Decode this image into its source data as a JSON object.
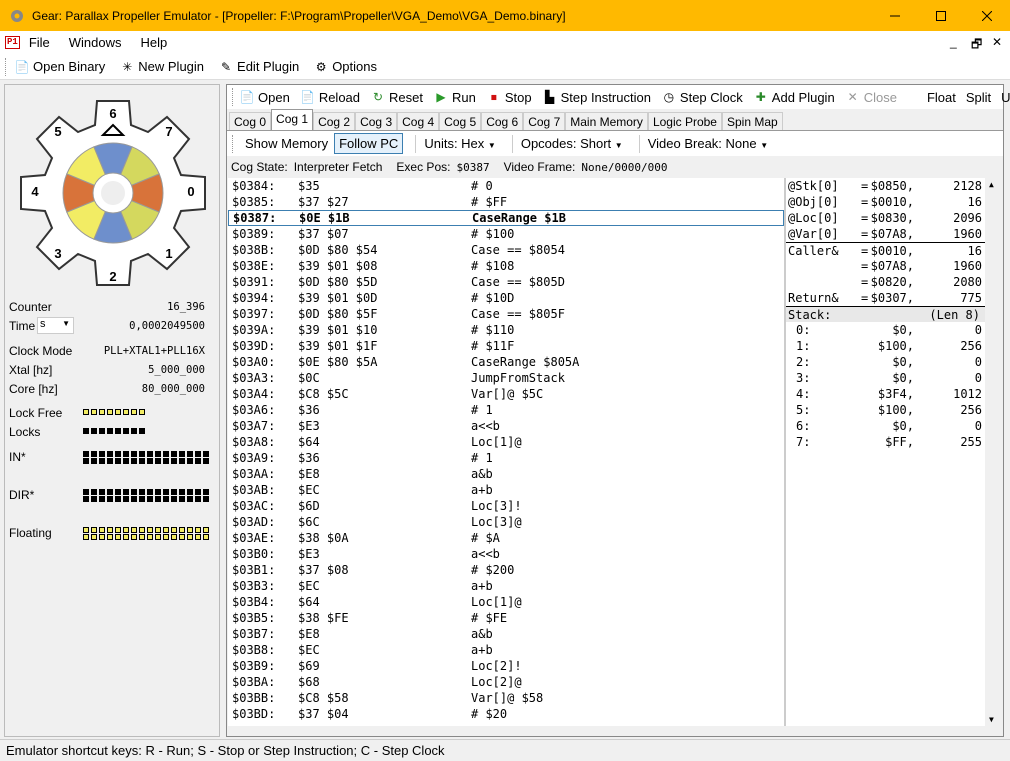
{
  "window": {
    "title": "Gear: Parallax Propeller Emulator - [Propeller: F:\\Program\\Propeller\\VGA_Demo\\VGA_Demo.binary]",
    "minimize": "—",
    "maximize": "☐",
    "close": "✕"
  },
  "menu": {
    "logo": "P1",
    "items": [
      "File",
      "Windows",
      "Help"
    ],
    "mdi_min": "_",
    "mdi_restore": "🗗",
    "mdi_close": "✕"
  },
  "toolbar1": {
    "open_binary": "Open Binary",
    "new_plugin": "New Plugin",
    "edit_plugin": "Edit Plugin",
    "options": "Options"
  },
  "gear": {
    "cogs": [
      "0",
      "1",
      "2",
      "3",
      "4",
      "5",
      "6",
      "7"
    ],
    "colors": {
      "blue": "#6e8fcc",
      "yellow": "#f2ec64",
      "orange": "#d8733a",
      "olive": "#d4d85e"
    }
  },
  "info": {
    "counter_label": "Counter",
    "counter_value": "16_396",
    "time_label": "Time",
    "time_unit": "s",
    "time_value": "0,0002049500",
    "clock_mode_label": "Clock Mode",
    "clock_mode_value": "PLL+XTAL1+PLL16X",
    "xtal_label": "Xtal [hz]",
    "xtal_value": "5_000_000",
    "core_label": "Core [hz]",
    "core_value": "80_000_000",
    "lock_free_label": "Lock Free",
    "locks_label": "Locks",
    "in_label": "IN*",
    "dir_label": "DIR*",
    "floating_label": "Floating"
  },
  "toolbar2": {
    "open": "Open",
    "reload": "Reload",
    "reset": "Reset",
    "run": "Run",
    "stop": "Stop",
    "step_instruction": "Step Instruction",
    "step_clock": "Step Clock",
    "add_plugin": "Add Plugin",
    "close": "Close",
    "float": "Float",
    "split": "Split",
    "unsplit": "Unsplit"
  },
  "tabs": [
    "Cog 0",
    "Cog 1",
    "Cog 2",
    "Cog 3",
    "Cog 4",
    "Cog 5",
    "Cog 6",
    "Cog 7",
    "Main Memory",
    "Logic Probe",
    "Spin Map"
  ],
  "toolbar3": {
    "show_memory": "Show Memory",
    "follow_pc": "Follow PC",
    "units": "Units: Hex",
    "opcodes": "Opcodes: Short",
    "video_break": "Video Break: None"
  },
  "cog_status": {
    "state_label": "Cog State:",
    "state_value": "Interpreter Fetch",
    "exec_label": "Exec Pos:",
    "exec_value": "$0387",
    "video_label": "Video Frame:",
    "video_value": "None/0000/000"
  },
  "code": [
    [
      "$0384:",
      "$35",
      "# 0"
    ],
    [
      "$0385:",
      "$37 $27",
      "# $FF"
    ],
    [
      "$0387:",
      "$0E $1B",
      "CaseRange $1B"
    ],
    [
      "$0389:",
      "$37 $07",
      "# $100"
    ],
    [
      "$038B:",
      "$0D $80 $54",
      "Case == $8054"
    ],
    [
      "$038E:",
      "$39 $01 $08",
      "# $108"
    ],
    [
      "$0391:",
      "$0D $80 $5D",
      "Case == $805D"
    ],
    [
      "$0394:",
      "$39 $01 $0D",
      "# $10D"
    ],
    [
      "$0397:",
      "$0D $80 $5F",
      "Case == $805F"
    ],
    [
      "$039A:",
      "$39 $01 $10",
      "# $110"
    ],
    [
      "$039D:",
      "$39 $01 $1F",
      "# $11F"
    ],
    [
      "$03A0:",
      "$0E $80 $5A",
      "CaseRange $805A"
    ],
    [
      "$03A3:",
      "$0C",
      "JumpFromStack"
    ],
    [
      "$03A4:",
      "$C8 $5C",
      "Var[]@ $5C"
    ],
    [
      "$03A6:",
      "$36",
      "# 1"
    ],
    [
      "$03A7:",
      "$E3",
      "a<<b"
    ],
    [
      "$03A8:",
      "$64",
      "Loc[1]@"
    ],
    [
      "$03A9:",
      "$36",
      "# 1"
    ],
    [
      "$03AA:",
      "$E8",
      "a&b"
    ],
    [
      "$03AB:",
      "$EC",
      "a+b"
    ],
    [
      "$03AC:",
      "$6D",
      "Loc[3]!"
    ],
    [
      "$03AD:",
      "$6C",
      "Loc[3]@"
    ],
    [
      "$03AE:",
      "$38 $0A",
      "# $A"
    ],
    [
      "$03B0:",
      "$E3",
      "a<<b"
    ],
    [
      "$03B1:",
      "$37 $08",
      "# $200"
    ],
    [
      "$03B3:",
      "$EC",
      "a+b"
    ],
    [
      "$03B4:",
      "$64",
      "Loc[1]@"
    ],
    [
      "$03B5:",
      "$38 $FE",
      "# $FE"
    ],
    [
      "$03B7:",
      "$E8",
      "a&b"
    ],
    [
      "$03B8:",
      "$EC",
      "a+b"
    ],
    [
      "$03B9:",
      "$69",
      "Loc[2]!"
    ],
    [
      "$03BA:",
      "$68",
      "Loc[2]@"
    ],
    [
      "$03BB:",
      "$C8 $58",
      "Var[]@ $58"
    ],
    [
      "$03BD:",
      "$37 $04",
      "# $20"
    ]
  ],
  "current_row": 2,
  "regs": [
    [
      "@Stk[0]",
      "=",
      "$0850,",
      "2128"
    ],
    [
      "@Obj[0]",
      "=",
      "$0010,",
      "16"
    ],
    [
      "@Loc[0]",
      "=",
      "$0830,",
      "2096"
    ],
    [
      "@Var[0]",
      "=",
      "$07A8,",
      "1960"
    ],
    [
      "Caller&",
      "=",
      "$0010,",
      "16"
    ],
    [
      "",
      "=",
      "$07A8,",
      "1960"
    ],
    [
      "",
      "=",
      "$0820,",
      "2080"
    ],
    [
      "Return&",
      "=",
      "$0307,",
      "775"
    ]
  ],
  "stack": {
    "label": "Stack:",
    "len": "(Len 8)",
    "items": [
      [
        "0:",
        "$0,",
        "0"
      ],
      [
        "1:",
        "$100,",
        "256"
      ],
      [
        "2:",
        "$0,",
        "0"
      ],
      [
        "3:",
        "$0,",
        "0"
      ],
      [
        "4:",
        "$3F4,",
        "1012"
      ],
      [
        "5:",
        "$100,",
        "256"
      ],
      [
        "6:",
        "$0,",
        "0"
      ],
      [
        "7:",
        "$FF,",
        "255"
      ]
    ]
  },
  "statusbar": "Emulator shortcut keys:  R - Run; S - Stop or Step Instruction; C - Step Clock"
}
